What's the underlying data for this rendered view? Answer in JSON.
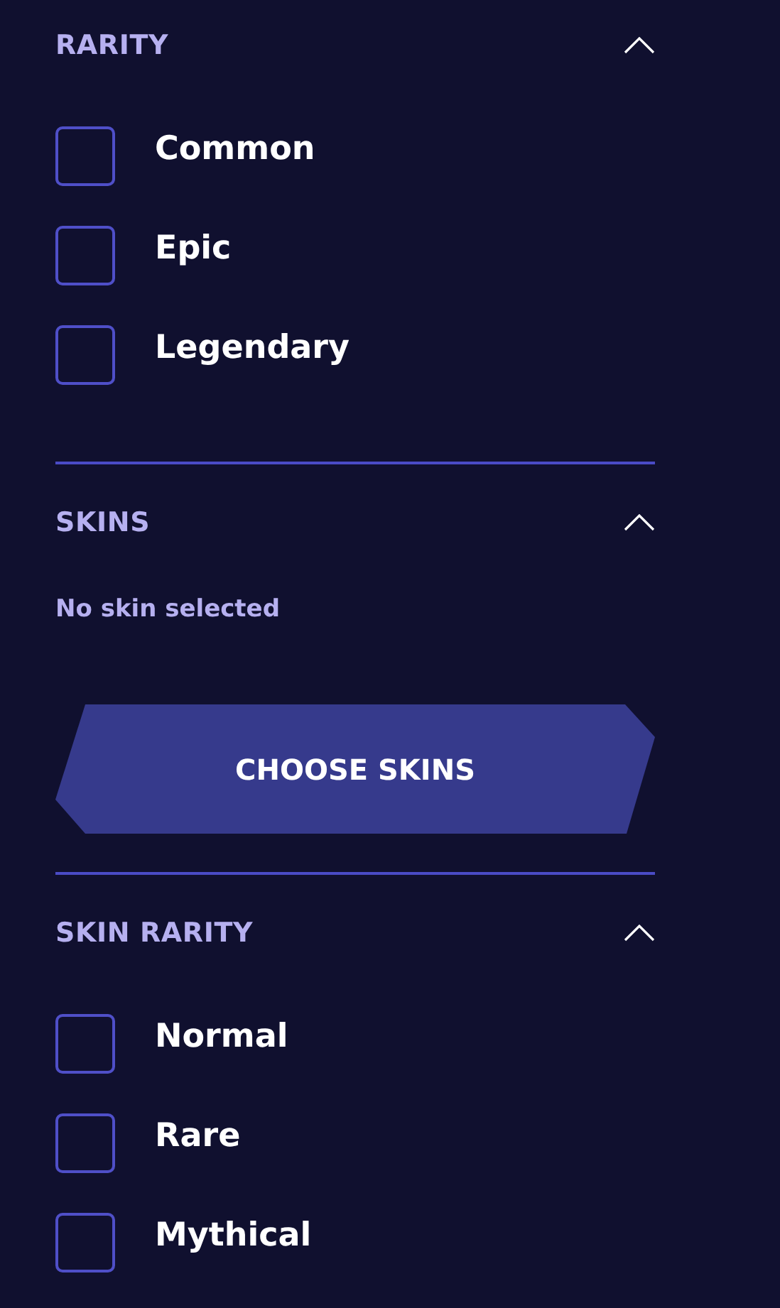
{
  "sections": [
    {
      "kind": "checklist",
      "title": "RARITY",
      "expanded": true,
      "options": [
        {
          "label": "Common",
          "checked": false
        },
        {
          "label": "Epic",
          "checked": false
        },
        {
          "label": "Legendary",
          "checked": false
        }
      ]
    },
    {
      "kind": "picker",
      "title": "SKINS",
      "expanded": true,
      "note": "No skin selected",
      "button": "CHOOSE SKINS"
    },
    {
      "kind": "checklist",
      "title": "SKIN RARITY",
      "expanded": true,
      "options": [
        {
          "label": "Normal",
          "checked": false
        },
        {
          "label": "Rare",
          "checked": false
        },
        {
          "label": "Mythical",
          "checked": false
        }
      ]
    }
  ]
}
